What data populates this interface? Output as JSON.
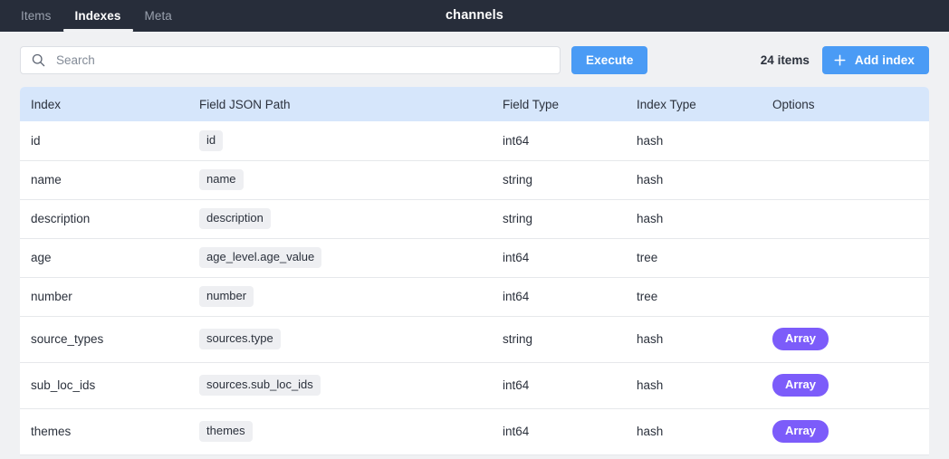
{
  "topbar": {
    "title": "channels",
    "tabs": [
      {
        "label": "Items",
        "active": false
      },
      {
        "label": "Indexes",
        "active": true
      },
      {
        "label": "Meta",
        "active": false
      }
    ]
  },
  "toolbar": {
    "search_placeholder": "Search",
    "search_value": "",
    "search_icon": "search-icon",
    "execute_label": "Execute",
    "item_count": "24 items",
    "add_index_label": "Add index",
    "add_index_icon": "plus-icon"
  },
  "table": {
    "columns": [
      "Index",
      "Field JSON Path",
      "Field Type",
      "Index Type",
      "Options"
    ],
    "rows": [
      {
        "index": "id",
        "path": "id",
        "field_type": "int64",
        "index_type": "hash",
        "option": ""
      },
      {
        "index": "name",
        "path": "name",
        "field_type": "string",
        "index_type": "hash",
        "option": ""
      },
      {
        "index": "description",
        "path": "description",
        "field_type": "string",
        "index_type": "hash",
        "option": ""
      },
      {
        "index": "age",
        "path": "age_level.age_value",
        "field_type": "int64",
        "index_type": "tree",
        "option": ""
      },
      {
        "index": "number",
        "path": "number",
        "field_type": "int64",
        "index_type": "tree",
        "option": ""
      },
      {
        "index": "source_types",
        "path": "sources.type",
        "field_type": "string",
        "index_type": "hash",
        "option": "Array"
      },
      {
        "index": "sub_loc_ids",
        "path": "sources.sub_loc_ids",
        "field_type": "int64",
        "index_type": "hash",
        "option": "Array"
      },
      {
        "index": "themes",
        "path": "themes",
        "field_type": "int64",
        "index_type": "hash",
        "option": "Array"
      }
    ]
  },
  "colors": {
    "topbar_bg": "#272d3a",
    "accent_blue": "#4a9bf5",
    "table_header_bg": "#d6e6fb",
    "badge_purple": "#7c5cfa",
    "page_bg": "#f0f1f3"
  }
}
